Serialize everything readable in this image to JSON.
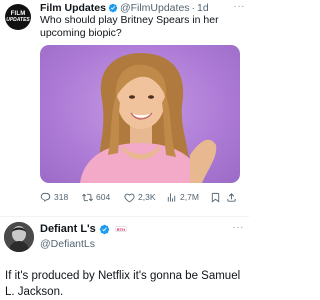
{
  "tweet": {
    "avatar_text": [
      "FILM",
      "UPDATES"
    ],
    "name": "Film Updates",
    "handle": "@FilmUpdates",
    "dot": "·",
    "time": "1d",
    "more": "···",
    "text": "Who should play Britney Spears in her upcoming biopic?",
    "media_icon": "portrait-photo",
    "actions": {
      "replies": "318",
      "retweets": "604",
      "likes": "2,3K",
      "views": "2,7M"
    }
  },
  "reply": {
    "name": "Defiant L's",
    "badge_text": "RTH",
    "handle": "@DefiantLs",
    "more": "···",
    "text": "If it's produced by Netflix it's gonna be Samuel L. Jackson."
  },
  "colors": {
    "verified": "#1d9bf0",
    "secondary_text": "#536471",
    "media_bg": "#ad7bd6"
  }
}
